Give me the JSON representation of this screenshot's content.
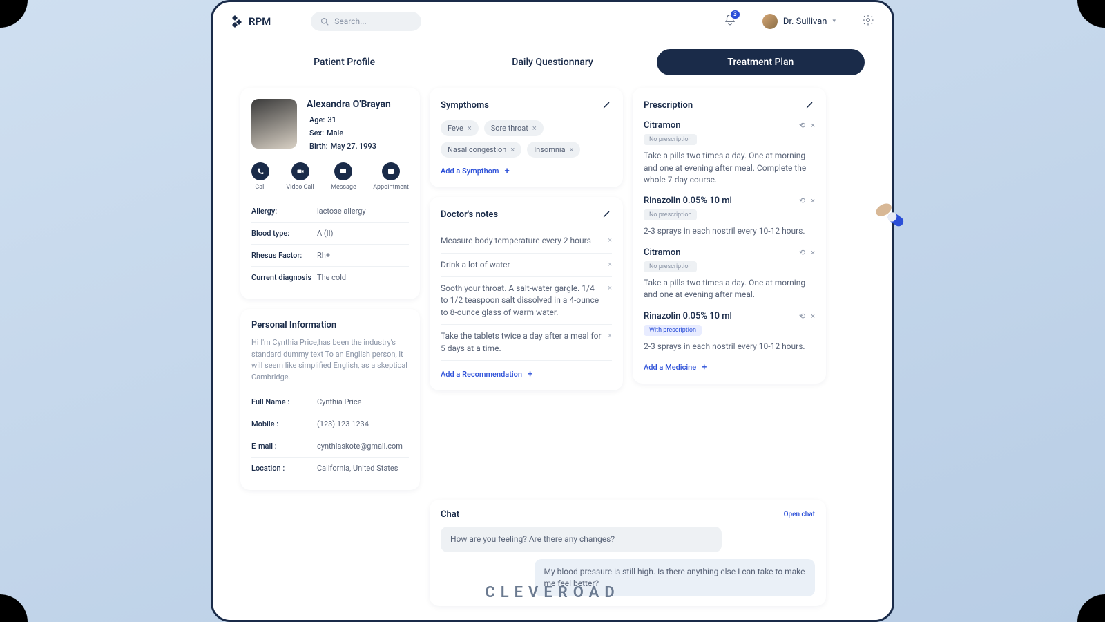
{
  "brand": "RPM",
  "search_placeholder": "Search...",
  "notif_count": "3",
  "user_name": "Dr. Sullivan",
  "tabs": [
    "Patient Profile",
    "Daily Questionnary",
    "Treatment Plan"
  ],
  "patient": {
    "name": "Alexandra O'Brayan",
    "age_k": "Age:",
    "age_v": "31",
    "sex_k": "Sex:",
    "sex_v": "Male",
    "birth_k": "Birth:",
    "birth_v": "May 27, 1993"
  },
  "actions": {
    "call": "Call",
    "video": "Video Call",
    "msg": "Message",
    "appt": "Appointment"
  },
  "medinfo": {
    "allergy_k": "Allergy:",
    "allergy_v": "lactose allergy",
    "blood_k": "Blood type:",
    "blood_v": "A (II)",
    "rh_k": "Rhesus Factor:",
    "rh_v": "Rh+",
    "diag_k": "Current diagnosis",
    "diag_v": "The cold"
  },
  "personal": {
    "title": "Personal Information",
    "desc": "Hi I'm Cynthia Price,has been the industry's standard dummy text To an English person, it will seem like simplified English, as a skeptical Cambridge.",
    "name_k": "Full Name :",
    "name_v": "Cynthia Price",
    "mobile_k": "Mobile :",
    "mobile_v": "(123) 123 1234",
    "email_k": "E-mail :",
    "email_v": "cynthiaskote@gmail.com",
    "loc_k": "Location :",
    "loc_v": "California, United States"
  },
  "symptoms": {
    "title": "Sympthoms",
    "chips": [
      "Feve",
      "Sore throat",
      "Nasal congestion",
      "Insomnia"
    ],
    "add": "Add a Sympthom"
  },
  "notes": {
    "title": "Doctor's notes",
    "items": [
      "Measure body temperature every 2 hours",
      "Drink a lot of water",
      "Sooth your throat. A salt-water gargle. 1/4 to 1/2 teaspoon salt dissolved in a 4-ounce to 8-ounce glass of warm water.",
      "Take the tablets twice a day after a meal for 5 days at a time."
    ],
    "add": "Add a Recommendation"
  },
  "rx": {
    "title": "Prescription",
    "items": [
      {
        "name": "Citramon",
        "badge": "No prescription",
        "txt": "Take a pills two times a day. One at morning and one at evening after meal. Complete the whole 7-day course.",
        "with": false
      },
      {
        "name": "Rinazolin 0.05% 10 ml",
        "badge": "No prescription",
        "txt": "2-3 sprays in each nostril every 10-12 hours.",
        "with": false
      },
      {
        "name": "Citramon",
        "badge": "No prescription",
        "txt": "Take a pills two times a day. One at morning and one at evening after meal.",
        "with": false
      },
      {
        "name": "Rinazolin 0.05% 10 ml",
        "badge": "With prescription",
        "txt": "2-3 sprays in each nostril every 10-12 hours.",
        "with": true
      }
    ],
    "add": "Add a Medicine"
  },
  "chat": {
    "title": "Chat",
    "open": "Open chat",
    "doc": "How are you feeling? Are there any changes?",
    "pat": "My blood pressure is still high. Is there anything else I can take to make me feel better?"
  },
  "footer": "CLEVEROAD"
}
